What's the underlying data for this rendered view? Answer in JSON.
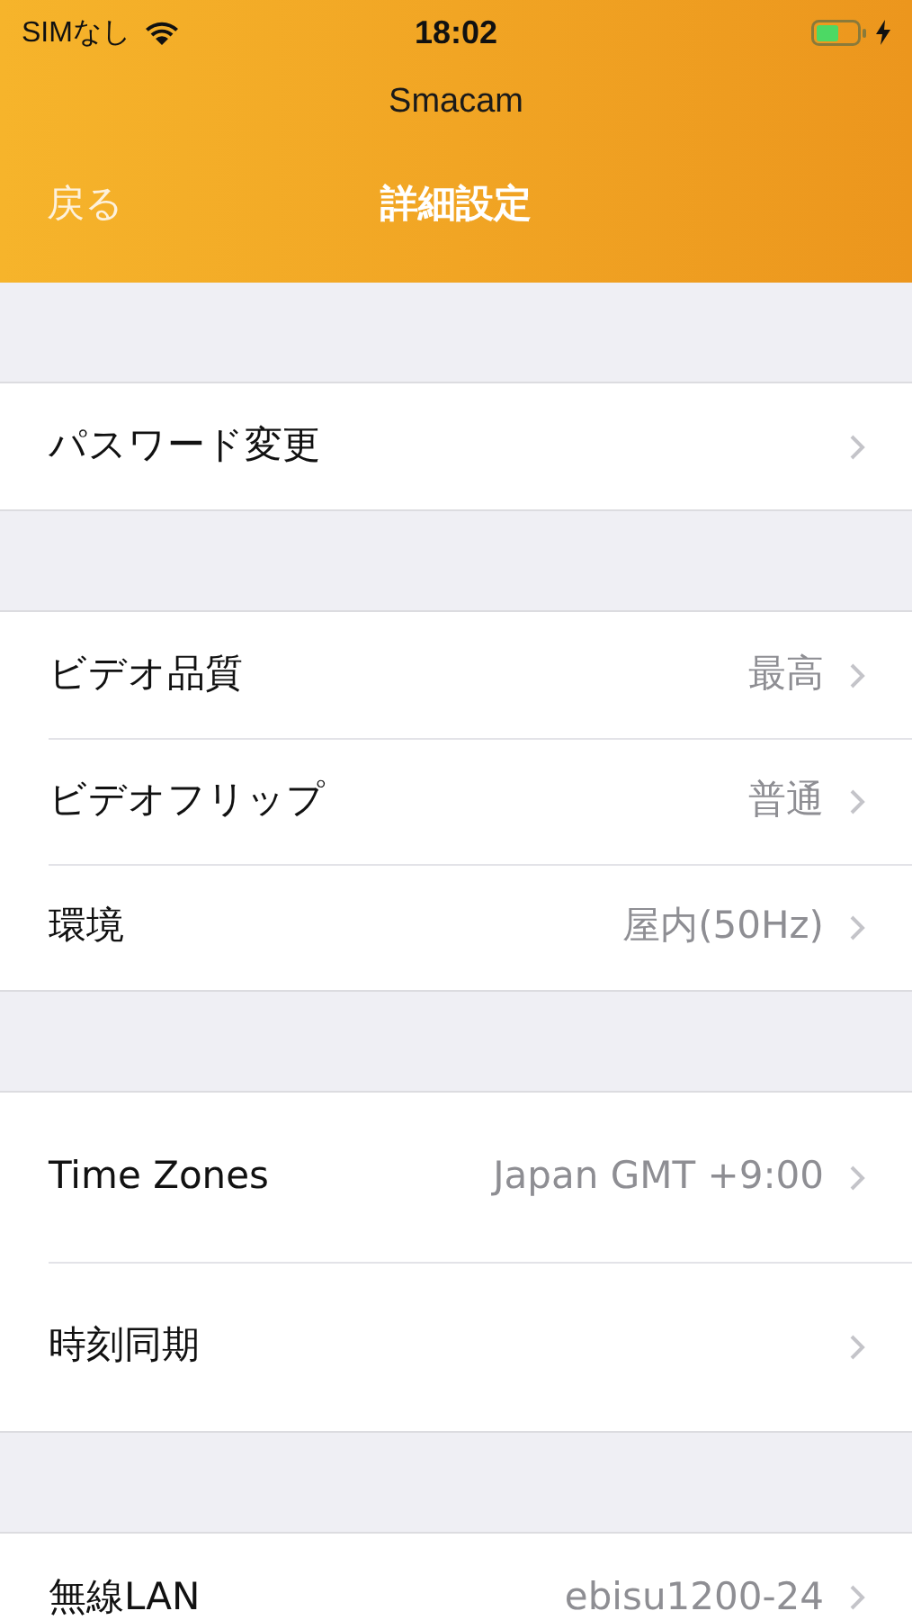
{
  "status_bar": {
    "carrier": "SIMなし",
    "time": "18:02"
  },
  "nav": {
    "app_name": "Smacam",
    "back": "戻る",
    "title": "詳細設定"
  },
  "sections": [
    {
      "rows": [
        {
          "label": "パスワード変更"
        }
      ]
    },
    {
      "rows": [
        {
          "label": "ビデオ品質",
          "value": "最高"
        },
        {
          "label": "ビデオフリップ",
          "value": "普通"
        },
        {
          "label": "環境",
          "value": "屋内(50Hz)"
        }
      ]
    },
    {
      "rows": [
        {
          "label": "Time Zones",
          "value": "Japan GMT +9:00"
        },
        {
          "label": "時刻同期"
        }
      ]
    },
    {
      "rows": [
        {
          "label": "無線LAN",
          "value": "ebisu1200-24"
        }
      ]
    }
  ]
}
